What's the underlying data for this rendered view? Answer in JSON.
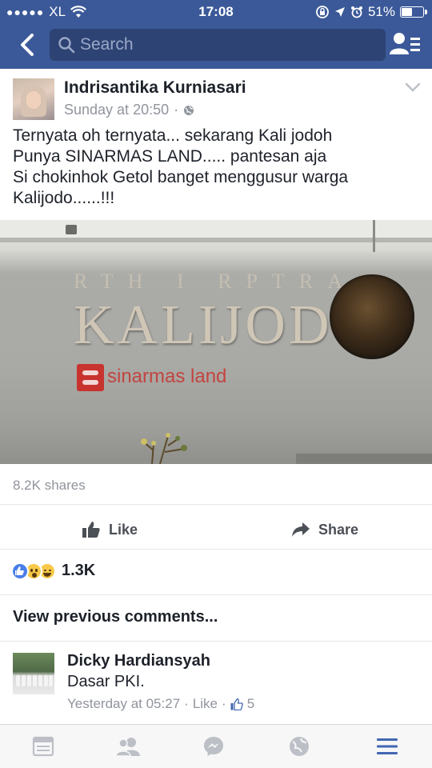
{
  "status_bar": {
    "carrier": "XL",
    "time": "17:08",
    "battery_percent_label": "51%",
    "battery_level": 0.51
  },
  "nav": {
    "search_placeholder": "Search"
  },
  "post": {
    "author": "Indrisantika Kurniasari",
    "timestamp": "Sunday at 20:50",
    "separator": "·",
    "privacy_icon": "globe-icon",
    "text": "Ternyata oh ternyata... sekarang Kali jodoh\nPunya SINARMAS LAND..... pantesan aja\nSi chokinhok Getol banget menggusur warga\nKalijodo......!!!",
    "photo_sign": {
      "top_line": "RTH  I  RPTRA",
      "main_line": "KALIJODO",
      "brand": "sinarmas land"
    },
    "shares": "8.2K shares",
    "actions": {
      "like": "Like",
      "share": "Share"
    },
    "reactions": {
      "icons": [
        "like-reaction-icon",
        "wow-reaction-icon",
        "haha-reaction-icon"
      ],
      "count": "1.3K"
    },
    "view_previous": "View previous comments..."
  },
  "comment": {
    "author": "Dicky Hardiansyah",
    "text": "Dasar PKI.",
    "time": "Yesterday at 05:27",
    "separator": "·",
    "like_label": "Like",
    "like_count": "5"
  },
  "colors": {
    "brand_blue": "#3b5998",
    "search_bg": "#2d4373",
    "meta_grey": "#90949c",
    "action_grey": "#4b4f56",
    "tab_active": "#4267b2",
    "tab_inactive": "#bcc0c6"
  },
  "tab_bar": {
    "items": [
      "news-feed-icon",
      "friends-icon",
      "messenger-icon",
      "globe-notifications-icon",
      "menu-icon"
    ],
    "active": "menu-icon"
  }
}
